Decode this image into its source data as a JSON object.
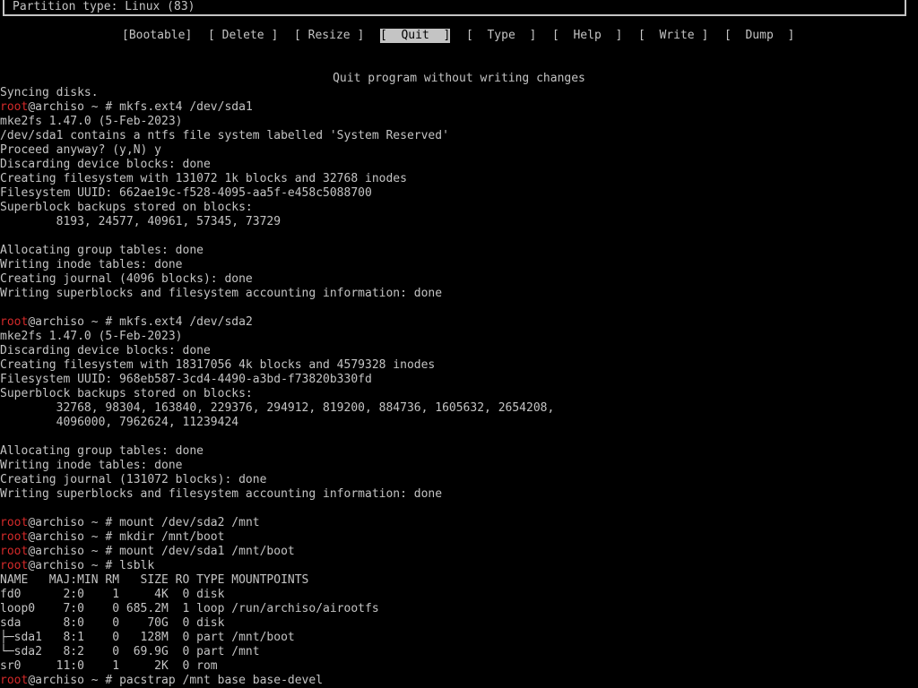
{
  "partition_type": "Partition type: Linux (83)",
  "menu": [
    {
      "label": "[Bootable]",
      "selected": false
    },
    {
      "label": "[ Delete ]",
      "selected": false
    },
    {
      "label": "[ Resize ]",
      "selected": false
    },
    {
      "label": "[  Quit  ]",
      "selected": true
    },
    {
      "label": "[  Type  ]",
      "selected": false
    },
    {
      "label": "[  Help  ]",
      "selected": false
    },
    {
      "label": "[  Write ]",
      "selected": false
    },
    {
      "label": "[  Dump  ]",
      "selected": false
    }
  ],
  "status": "Quit program without writing changes",
  "prompt_user": "root",
  "prompt_host": "@archiso ~ # ",
  "terminal": [
    {
      "text": "Syncing disks."
    },
    {
      "prompt": true,
      "text": "mkfs.ext4 /dev/sda1"
    },
    {
      "text": "mke2fs 1.47.0 (5-Feb-2023)"
    },
    {
      "text": "/dev/sda1 contains a ntfs file system labelled 'System Reserved'"
    },
    {
      "text": "Proceed anyway? (y,N) y"
    },
    {
      "text": "Discarding device blocks: done"
    },
    {
      "text": "Creating filesystem with 131072 1k blocks and 32768 inodes"
    },
    {
      "text": "Filesystem UUID: 662ae19c-f528-4095-aa5f-e458c5088700"
    },
    {
      "text": "Superblock backups stored on blocks:"
    },
    {
      "text": "        8193, 24577, 40961, 57345, 73729"
    },
    {
      "text": ""
    },
    {
      "text": "Allocating group tables: done"
    },
    {
      "text": "Writing inode tables: done"
    },
    {
      "text": "Creating journal (4096 blocks): done"
    },
    {
      "text": "Writing superblocks and filesystem accounting information: done"
    },
    {
      "text": ""
    },
    {
      "prompt": true,
      "text": "mkfs.ext4 /dev/sda2"
    },
    {
      "text": "mke2fs 1.47.0 (5-Feb-2023)"
    },
    {
      "text": "Discarding device blocks: done"
    },
    {
      "text": "Creating filesystem with 18317056 4k blocks and 4579328 inodes"
    },
    {
      "text": "Filesystem UUID: 968eb587-3cd4-4490-a3bd-f73820b330fd"
    },
    {
      "text": "Superblock backups stored on blocks:"
    },
    {
      "text": "        32768, 98304, 163840, 229376, 294912, 819200, 884736, 1605632, 2654208,"
    },
    {
      "text": "        4096000, 7962624, 11239424"
    },
    {
      "text": ""
    },
    {
      "text": "Allocating group tables: done"
    },
    {
      "text": "Writing inode tables: done"
    },
    {
      "text": "Creating journal (131072 blocks): done"
    },
    {
      "text": "Writing superblocks and filesystem accounting information: done"
    },
    {
      "text": ""
    },
    {
      "prompt": true,
      "text": "mount /dev/sda2 /mnt"
    },
    {
      "prompt": true,
      "text": "mkdir /mnt/boot"
    },
    {
      "prompt": true,
      "text": "mount /dev/sda1 /mnt/boot"
    },
    {
      "prompt": true,
      "text": "lsblk"
    },
    {
      "text": "NAME   MAJ:MIN RM   SIZE RO TYPE MOUNTPOINTS"
    },
    {
      "text": "fd0      2:0    1     4K  0 disk"
    },
    {
      "text": "loop0    7:0    0 685.2M  1 loop /run/archiso/airootfs"
    },
    {
      "text": "sda      8:0    0    70G  0 disk"
    },
    {
      "text": "├─sda1   8:1    0   128M  0 part /mnt/boot"
    },
    {
      "text": "└─sda2   8:2    0  69.9G  0 part /mnt"
    },
    {
      "text": "sr0     11:0    1     2K  0 rom"
    },
    {
      "prompt": true,
      "text": "pacstrap /mnt base base-devel"
    }
  ]
}
